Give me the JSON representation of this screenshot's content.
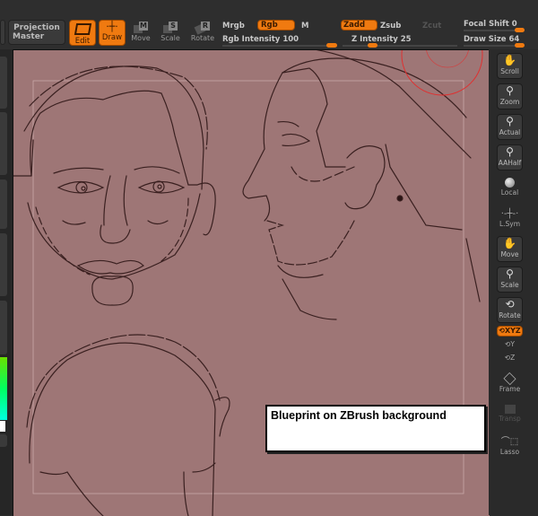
{
  "toolbar": {
    "projection_master": {
      "line1": "Projection",
      "line2": "Master"
    },
    "edit": "Edit",
    "draw": "Draw",
    "move": {
      "label": "Move",
      "key": "M"
    },
    "scale": {
      "label": "Scale",
      "key": "S"
    },
    "rotate": {
      "label": "Rotate",
      "key": "R"
    },
    "mrgb": "Mrgb",
    "rgb": "Rgb",
    "m": "M",
    "rgb_intensity": {
      "label": "Rgb Intensity",
      "value": "100"
    },
    "zadd": "Zadd",
    "zsub": "Zsub",
    "zcut": "Zcut",
    "z_intensity": {
      "label": "Z Intensity",
      "value": "25"
    },
    "focal_shift": {
      "label": "Focal Shift",
      "value": "0"
    },
    "draw_size": {
      "label": "Draw Size",
      "value": "64"
    }
  },
  "right_shelf": {
    "scroll": "Scroll",
    "zoom": "Zoom",
    "actual": "Actual",
    "aahalf": "AAHalf",
    "local": "Local",
    "lsym": "L.Sym",
    "move": "Move",
    "scale": "Scale",
    "rotate": "Rotate",
    "xyz": "XYZ",
    "y": "Y",
    "z": "Z",
    "frame": "Frame",
    "transp": "Transp",
    "lasso": "Lasso"
  },
  "colors": {
    "accent": "#f07a10",
    "canvas": "#9e7676",
    "sketch_line": "#3a2020",
    "brush_circle": "#e03030"
  },
  "annotation": {
    "text": "Blueprint on ZBrush background"
  }
}
